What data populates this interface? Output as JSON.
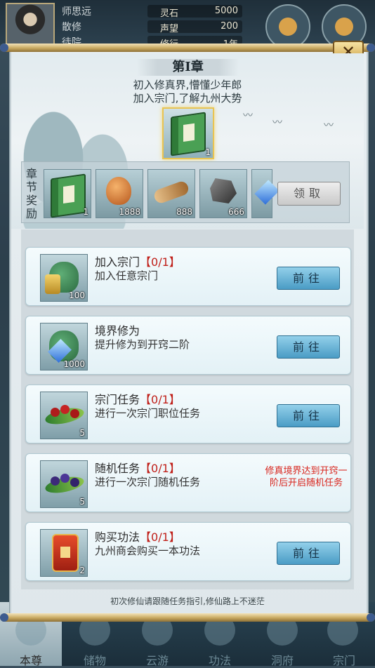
{
  "hud": {
    "player_name": "师思远",
    "sect": "散修",
    "rank": "徒院",
    "stats": [
      {
        "label": "灵石",
        "value": "5000"
      },
      {
        "label": "声望",
        "value": "200"
      },
      {
        "label": "修行",
        "value": "1年"
      }
    ]
  },
  "dialog": {
    "close_label": "✕",
    "chapter_title": "第Ⅰ章",
    "intro_lines": [
      "初入修真界,懵懂少年郎",
      "加入宗门,了解九州大势"
    ],
    "main_item_count": "1",
    "reward_label_chars": [
      "章",
      "节",
      "奖",
      "励"
    ],
    "rewards": [
      {
        "name": "功法书",
        "count": "1"
      },
      {
        "name": "鸡腿",
        "count": "1888"
      },
      {
        "name": "木材",
        "count": "888"
      },
      {
        "name": "玄铁矿",
        "count": "666"
      },
      {
        "name": "灵石",
        "count": ""
      }
    ],
    "claim_label": "领取",
    "tasks": [
      {
        "title": "加入宗门",
        "progress": "【0/1】",
        "desc": "加入任意宗门",
        "icon": "sect-bag-icon",
        "count": "100",
        "action": "前往"
      },
      {
        "title": "境界修为",
        "progress": "",
        "desc": "提升修为到开窍二阶",
        "icon": "spirit-stone-bag-icon",
        "count": "1000",
        "action": "前往"
      },
      {
        "title": "宗门任务",
        "progress": "【0/1】",
        "desc": "进行一次宗门职位任务",
        "icon": "red-berry-icon",
        "count": "5",
        "action": "前往"
      },
      {
        "title": "随机任务",
        "progress": "【0/1】",
        "desc": "进行一次宗门随机任务",
        "icon": "purple-berry-icon",
        "count": "5",
        "locked_note": "修真境界达到开窍一阶后开启随机任务"
      },
      {
        "title": "购买功法",
        "progress": "【0/1】",
        "desc": "九州商会购买一本功法",
        "icon": "manual-icon",
        "count": "2",
        "action": "前往"
      }
    ],
    "footer_hint": "初次修仙请跟随任务指引,修仙路上不迷茫"
  },
  "bottom_nav": {
    "items": [
      "本尊",
      "储物",
      "云游",
      "功法",
      "洞府",
      "宗门"
    ]
  },
  "colors": {
    "progress_red": "#c0201a",
    "go_button_blue": "#4a9cc5",
    "locked_note_red": "#d8241c",
    "rail_gold": "#c7a860"
  }
}
